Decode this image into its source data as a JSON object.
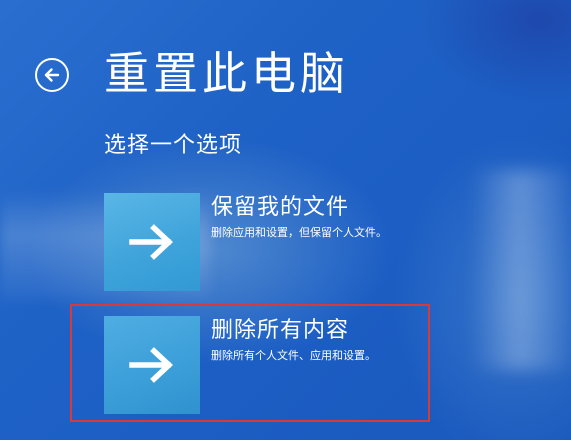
{
  "header": {
    "title": "重置此电脑",
    "back_icon": "back-arrow-circle-icon"
  },
  "main": {
    "subtitle": "选择一个选项",
    "options": [
      {
        "title": "保留我的文件",
        "description": "删除应用和设置，但保留个人文件。",
        "icon": "arrow-right-icon"
      },
      {
        "title": "删除所有内容",
        "description": "删除所有个人文件、应用和设置。",
        "icon": "arrow-right-icon"
      }
    ]
  },
  "annotation": {
    "highlight_color": "#d63a3a",
    "highlighted_option": "删除所有内容"
  },
  "colors": {
    "background": "#1f62c6",
    "tile": "#3ea3da",
    "text": "#ffffff"
  }
}
